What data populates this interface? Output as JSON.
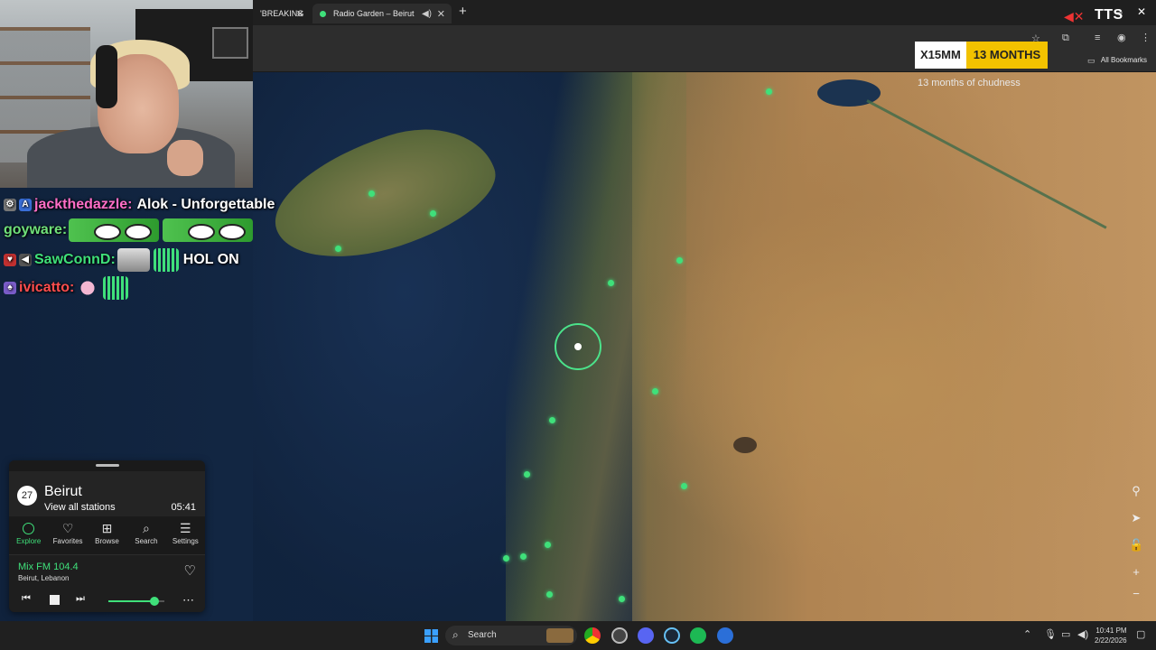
{
  "browser": {
    "tabs": [
      {
        "label": "'BREAKING",
        "active": false
      },
      {
        "label": "Radio Garden – Beirut",
        "active": true
      }
    ],
    "new_tab_icon": "plus-icon",
    "all_bookmarks": "All Bookmarks"
  },
  "overlay": {
    "tts": "TTS",
    "sub_code": "X15MM",
    "sub_months": "13 MONTHS",
    "sub_caption": "13 months of chudness"
  },
  "chat": [
    {
      "user": "jackthedazzle:",
      "color": "#ff6ec7",
      "message": "Alok - Unforgettable"
    },
    {
      "user": "goyware:",
      "color": "#6fe07a",
      "message": ""
    },
    {
      "user": "SawConnD:",
      "color": "#3fe07a",
      "message": "HOL ON"
    },
    {
      "user": "ivicatto:",
      "color": "#ff4d4d",
      "message": ""
    }
  ],
  "radio": {
    "station_count": "27",
    "city": "Beirut",
    "view_all": "View all stations",
    "local_time": "05:41",
    "nav": [
      {
        "label": "Explore",
        "icon": "explore-ring-icon"
      },
      {
        "label": "Favorites",
        "icon": "heart-icon"
      },
      {
        "label": "Browse",
        "icon": "map-icon"
      },
      {
        "label": "Search",
        "icon": "search-icon"
      },
      {
        "label": "Settings",
        "icon": "menu-icon"
      }
    ],
    "station_name": "Mix FM 104.4",
    "station_location": "Beirut, Lebanon",
    "volume": 0.82,
    "accent": "#3fe07a"
  },
  "taskbar": {
    "search_label": "Search",
    "time": "10:41 PM",
    "date": "2/22/2026"
  }
}
